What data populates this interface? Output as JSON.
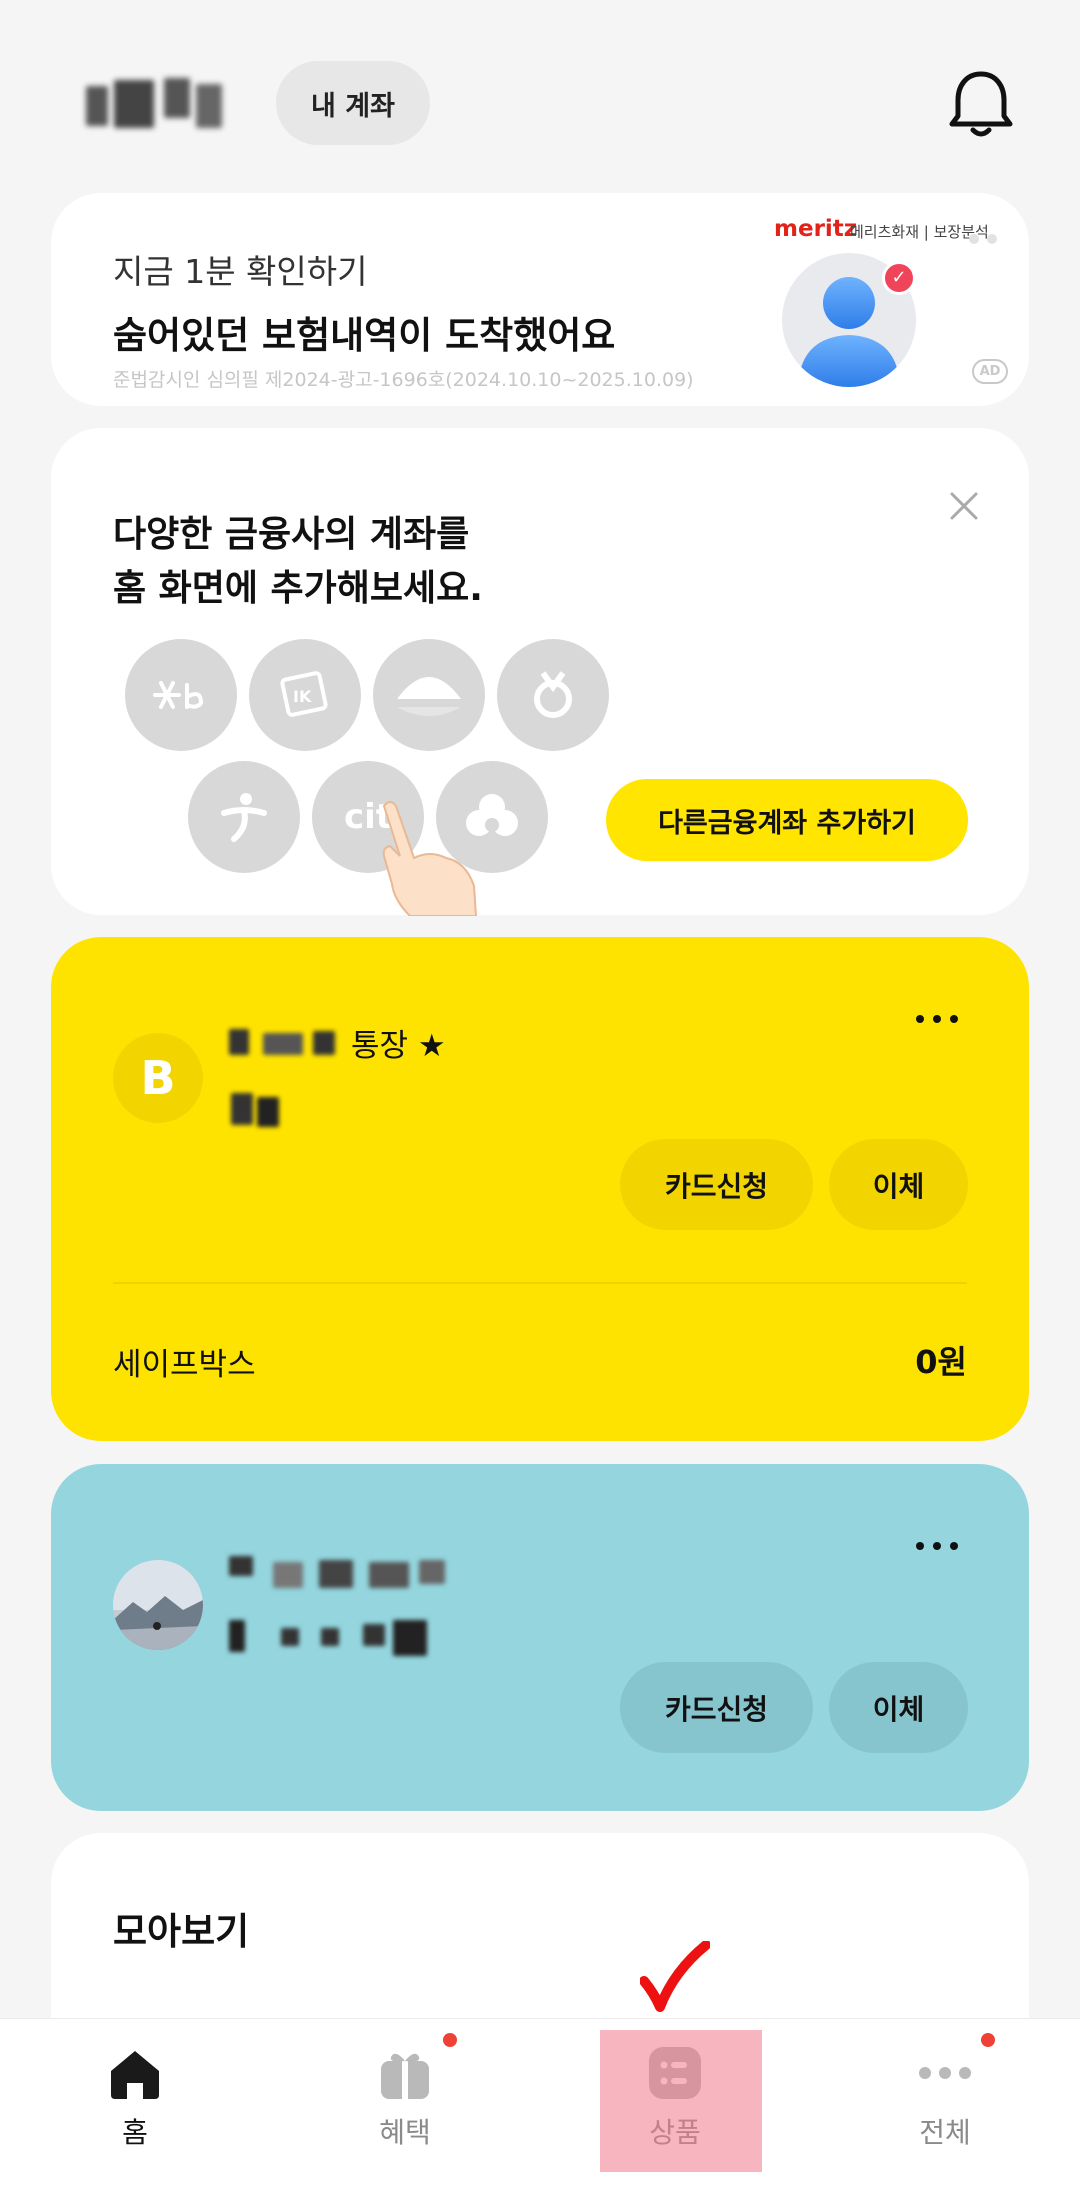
{
  "header": {
    "account_button": "내 계좌"
  },
  "ad": {
    "subtitle": "지금 1분 확인하기",
    "title": "숨어있던 보험내역이 도착했어요",
    "legal": "준법감시인 심의필 제2024-광고-1696호(2024.10.10~2025.10.09)",
    "brand": "meritz",
    "brand_sub": "메리츠화재 | 보장분석",
    "badge": "AD"
  },
  "bank_promo": {
    "title_line1": "다양한 금융사의 계좌를",
    "title_line2": "홈 화면에 추가해보세요.",
    "add_button": "다른금융계좌 추가하기",
    "logos": [
      "kb-logo",
      "ibk-logo",
      "woori-logo",
      "nh-logo",
      "hana-logo",
      "citi-logo",
      "shinhan-logo"
    ]
  },
  "account1": {
    "name_visible": "통장 ★",
    "card_button": "카드신청",
    "transfer_button": "이체",
    "safebox_label": "세이프박스",
    "safebox_amount": "0원",
    "color": "#ffe300"
  },
  "account2": {
    "card_button": "카드신청",
    "transfer_button": "이체",
    "color": "#94d5de"
  },
  "collection": {
    "title": "모아보기"
  },
  "nav": {
    "home": "홈",
    "benefits": "혜택",
    "products": "상품",
    "all": "전체"
  }
}
